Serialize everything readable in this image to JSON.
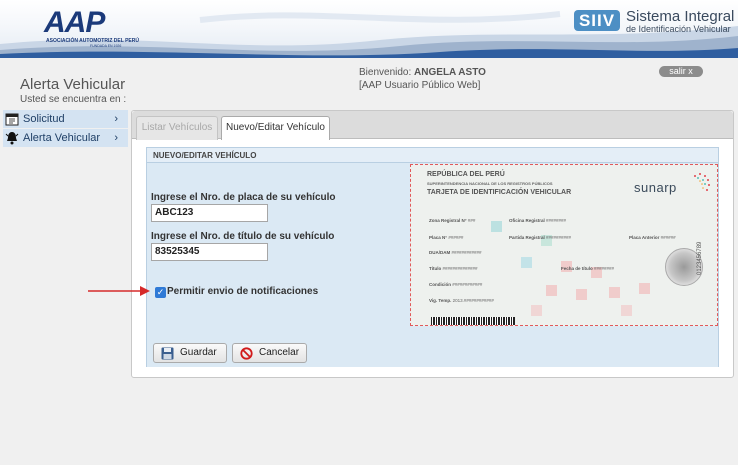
{
  "header": {
    "logo_text": "AAP",
    "logo_subtitle": "ASOCIACIÓN AUTOMOTRIZ DEL PERÚ",
    "logo_tagline": "FUNDADA EN 1926",
    "system_badge": "SIIV",
    "system_title": "Sistema Integral",
    "system_subtitle": "de Identificación Vehicular"
  },
  "top": {
    "page_title": "Alerta Vehicular",
    "breadcrumb": "Usted se encuentra en :",
    "welcome_prefix": "Bienvenido:",
    "user_name": "ANGELA ASTO",
    "user_type": "[AAP Usuario Público Web]",
    "logout_label": "salir x"
  },
  "sidebar": {
    "items": [
      {
        "label": "Solicitud",
        "icon": "calendar-icon"
      },
      {
        "label": "Alerta Vehicular",
        "icon": "bell-icon"
      }
    ],
    "chevron": "›"
  },
  "tabs": [
    {
      "label": "Listar Vehículos",
      "active": false
    },
    {
      "label": "Nuevo/Editar Vehículo",
      "active": true
    }
  ],
  "form": {
    "section_title": "NUEVO/EDITAR VEHÍCULO",
    "plate_label": "Ingrese el Nro. de placa de su vehículo",
    "plate_value": "ABC123",
    "title_label": "Ingrese el Nro. de título de su vehículo",
    "title_value": "83525345",
    "notify_label": "Permitir envio de notificaciones",
    "notify_checked": true,
    "save_label": "Guardar",
    "cancel_label": "Cancelar"
  },
  "card": {
    "line1": "REPÚBLICA DEL PERÚ",
    "line2": "SUPERINTENDENCIA NACIONAL DE LOS REGISTROS PÚBLICOS",
    "line3": "TARJETA DE IDENTIFICACIÓN VEHICULAR",
    "brand": "sunarp",
    "zona_label": "Zona Registral N°",
    "zona_value": "###",
    "oficina_label": "Oficina Registral",
    "oficina_value": "########",
    "placa_label": "Placa N°",
    "placa_value": "######",
    "partida_label": "Partida Registral",
    "partida_value": "##########",
    "placa_ant_label": "Placa Anterior",
    "placa_ant_value": "######",
    "dua_label": "DUA/DAM",
    "dua_value": "############",
    "titulo_label": "Título",
    "titulo_value": "##############",
    "fecha_label": "Fecha de título",
    "fecha_value": "########",
    "condicion_label": "Condición",
    "condicion_value": "############",
    "vig_label": "Vig. Temp.",
    "vig_value": "2013.############",
    "vertical_number": "0123456789"
  },
  "colors": {
    "brand_blue": "#1b3a7a",
    "siiv_blue": "#4d8fc4",
    "sidebar_bg": "#d4e3f2",
    "form_bg": "#dbe9f4",
    "arrow_red": "#d62a2a",
    "checkbox_blue": "#2f7ad6"
  }
}
